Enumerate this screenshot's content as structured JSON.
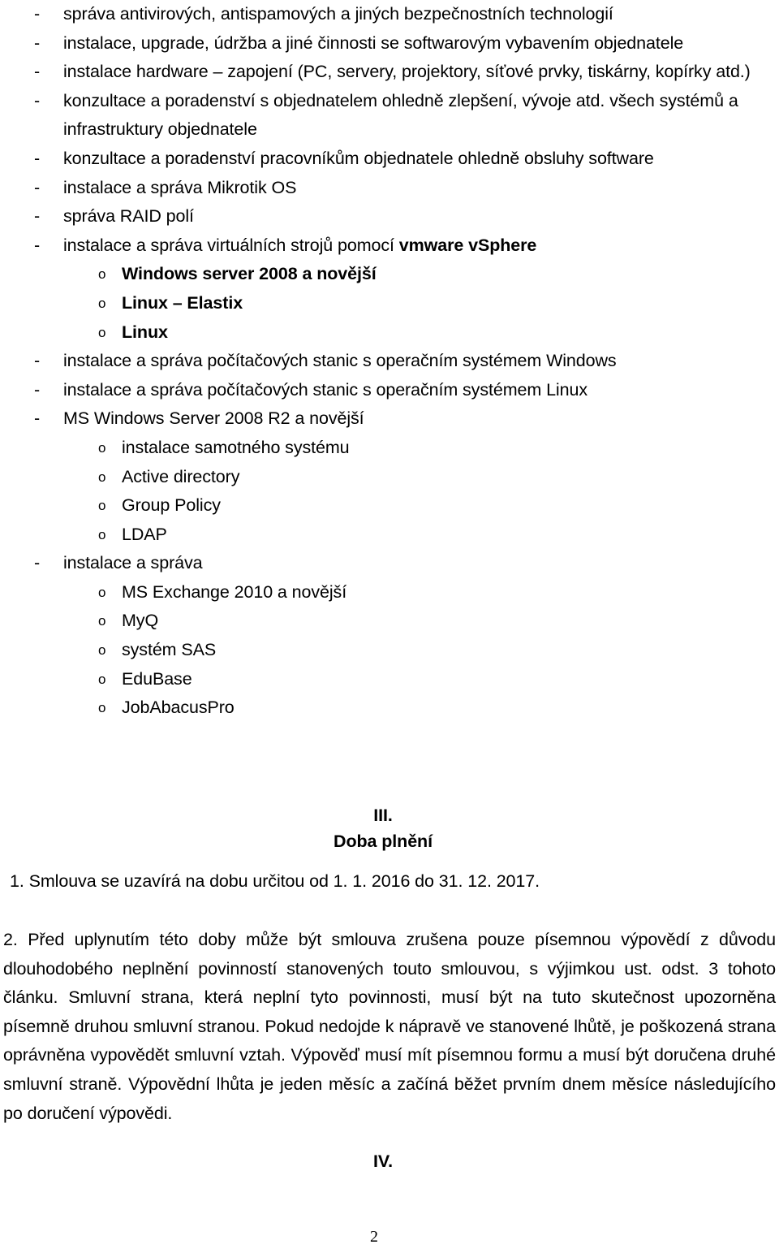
{
  "document": {
    "page_number": "2",
    "bullets": [
      {
        "level": 1,
        "marker": "-",
        "text": "správa antivirových, antispamových a jiných bezpečnostních technologií",
        "bold": false
      },
      {
        "level": 1,
        "marker": "-",
        "text": "instalace, upgrade, údržba a jiné činnosti se softwarovým vybavením objednatele",
        "bold": false
      },
      {
        "level": 1,
        "marker": "-",
        "text": "instalace hardware – zapojení (PC, servery, projektory, síťové prvky, tiskárny, kopírky atd.)",
        "bold": false
      },
      {
        "level": 1,
        "marker": "-",
        "text": "konzultace a poradenství s objednatelem ohledně zlepšení, vývoje atd. všech systémů a infrastruktury objednatele",
        "bold": false
      },
      {
        "level": 1,
        "marker": "-",
        "text": "konzultace a poradenství pracovníkům objednatele ohledně obsluhy software",
        "bold": false
      },
      {
        "level": 1,
        "marker": "-",
        "text": "instalace a správa Mikrotik OS",
        "bold": false
      },
      {
        "level": 1,
        "marker": "-",
        "text": "správa RAID polí",
        "bold": false
      },
      {
        "level": 1,
        "marker": "-",
        "text_plain": "instalace a správa virtuálních strojů pomocí ",
        "text_bold": "vmware vSphere",
        "bold": false
      },
      {
        "level": 2,
        "marker": "o",
        "text": "Windows server 2008 a novější",
        "bold": true
      },
      {
        "level": 2,
        "marker": "o",
        "text": "Linux – Elastix",
        "bold": true
      },
      {
        "level": 2,
        "marker": "o",
        "text": "Linux",
        "bold": true
      },
      {
        "level": 1,
        "marker": "-",
        "text": "instalace a správa počítačových stanic s operačním systémem Windows",
        "bold": false
      },
      {
        "level": 1,
        "marker": "-",
        "text": "instalace a správa počítačových stanic s operačním systémem Linux",
        "bold": false
      },
      {
        "level": 1,
        "marker": "-",
        "text": "MS Windows Server 2008 R2 a novější",
        "bold": false
      },
      {
        "level": 2,
        "marker": "o",
        "text": "instalace samotného systému",
        "bold": false
      },
      {
        "level": 2,
        "marker": "o",
        "text": "Active directory",
        "bold": false
      },
      {
        "level": 2,
        "marker": "o",
        "text": "Group Policy",
        "bold": false
      },
      {
        "level": 2,
        "marker": "o",
        "text": "LDAP",
        "bold": false
      },
      {
        "level": 1,
        "marker": "-",
        "text": "instalace a správa",
        "bold": false
      },
      {
        "level": 2,
        "marker": "o",
        "text": "MS Exchange 2010 a novější",
        "bold": false
      },
      {
        "level": 2,
        "marker": "o",
        "text": "MyQ",
        "bold": false
      },
      {
        "level": 2,
        "marker": "o",
        "text": "systém SAS",
        "bold": false
      },
      {
        "level": 2,
        "marker": "o",
        "text": "EduBase",
        "bold": false
      },
      {
        "level": 2,
        "marker": "o",
        "text": "JobAbacusPro",
        "bold": false
      }
    ],
    "section_three": {
      "numeral": "III.",
      "title": "Doba plnění"
    },
    "paragraph_1": "1. Smlouva se uzavírá na dobu určitou od  1. 1. 2016   do 31. 12. 2017.",
    "paragraph_2": "2. Před uplynutím této doby může být smlouva zrušena pouze písemnou výpovědí z důvodu dlouhodobého neplnění povinností stanovených touto smlouvou, s výjimkou ust. odst. 3 tohoto článku.  Smluvní strana, která neplní tyto povinnosti, musí být na tuto skutečnost upozorněna písemně druhou smluvní stranou. Pokud nedojde k nápravě ve stanovené lhůtě, je poškozená strana oprávněna vypovědět smluvní vztah. Výpověď musí mít písemnou formu a musí být doručena druhé smluvní straně. Výpovědní lhůta je jeden měsíc a začíná běžet prvním dnem měsíce následujícího po doručení výpovědi.",
    "section_four": {
      "numeral": "IV."
    }
  }
}
